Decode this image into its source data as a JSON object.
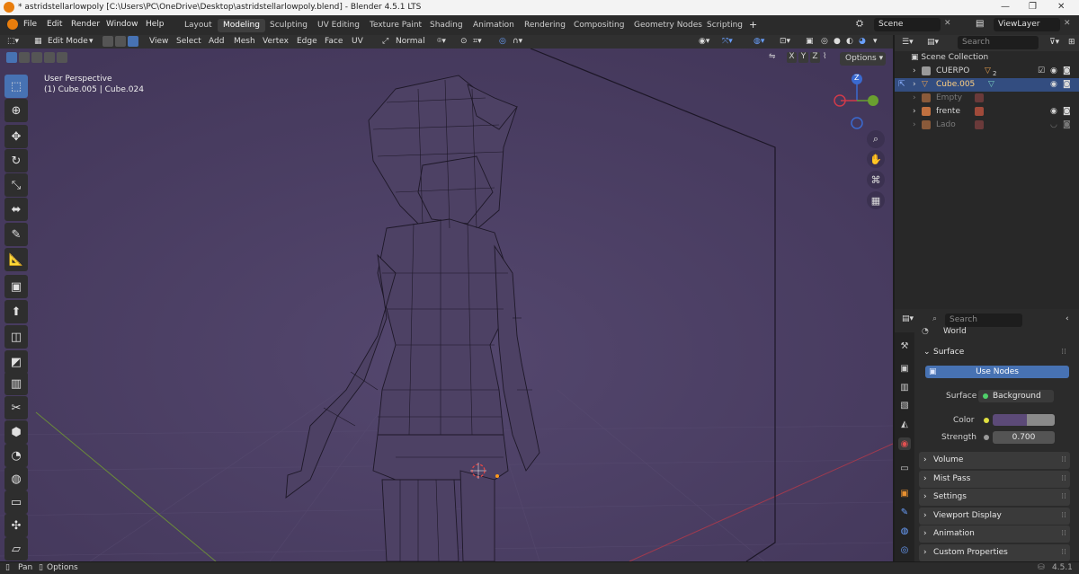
{
  "window": {
    "title": "* astridstellarlowpoly [C:\\Users\\PC\\OneDrive\\Desktop\\astridstellarlowpoly.blend] - Blender 4.5.1 LTS",
    "minimize": "—",
    "maximize": "❐",
    "close": "✕"
  },
  "menu": {
    "items": [
      "File",
      "Edit",
      "Render",
      "Window",
      "Help"
    ],
    "workspaces": [
      "Layout",
      "Modeling",
      "Sculpting",
      "UV Editing",
      "Texture Paint",
      "Shading",
      "Animation",
      "Rendering",
      "Compositing",
      "Geometry Nodes",
      "Scripting"
    ],
    "active_workspace": "Modeling",
    "add_tab": "+",
    "scene": "Scene",
    "view_layer": "ViewLayer"
  },
  "viewport_header": {
    "mode": "Edit Mode",
    "menus": [
      "View",
      "Select",
      "Add",
      "Mesh",
      "Vertex",
      "Edge",
      "Face",
      "UV"
    ],
    "orientation": "Normal",
    "axes": [
      "X",
      "Y",
      "Z"
    ],
    "options": "Options"
  },
  "viewport": {
    "perspective": "User Perspective",
    "object_info": "(1) Cube.005 | Cube.024",
    "background_color": "#4a3d63",
    "gizmo": {
      "x_label": "",
      "y_label": "",
      "z_label": "Z"
    }
  },
  "toolbar": {
    "tools": [
      "select-box",
      "cursor",
      "move",
      "rotate",
      "scale",
      "transform",
      "annotate",
      "measure",
      "add-cube",
      "extrude",
      "inset",
      "bevel",
      "loop-cut",
      "knife",
      "poly-build",
      "spin",
      "smooth",
      "edge-slide",
      "shrink-fatten",
      "shear"
    ],
    "glyphs": [
      "⬚",
      "⊕",
      "✥",
      "↻",
      "⤡",
      "⬌",
      "✎",
      "📐",
      "▣",
      "⬆",
      "◫",
      "◩",
      "▥",
      "✂",
      "⬢",
      "◔",
      "◍",
      "▭",
      "✣",
      "▱"
    ]
  },
  "outliner": {
    "search_placeholder": "Search",
    "root": "Scene Collection",
    "rows": [
      {
        "name": "CUERPO",
        "sub": "2",
        "color": "#9a9a9a"
      },
      {
        "name": "Cube.005",
        "sub": "",
        "color": "#e0a040"
      },
      {
        "name": "Empty",
        "sub": "",
        "color": "#7a7a7a"
      },
      {
        "name": "frente",
        "sub": "",
        "color": "#d0d0d0"
      },
      {
        "name": "Lado",
        "sub": "",
        "color": "#7a7a7a"
      }
    ]
  },
  "properties": {
    "search_placeholder": "Search",
    "world_name": "World",
    "surface_panel": "Surface",
    "use_nodes": "Use Nodes",
    "surface_label": "Surface",
    "surface_value": "Background",
    "color_label": "Color",
    "color_value": "#5c4a78",
    "strength_label": "Strength",
    "strength_value": "0.700",
    "panels": [
      "Volume",
      "Mist Pass",
      "Settings",
      "Viewport Display",
      "Animation",
      "Custom Properties"
    ]
  },
  "status": {
    "pan": "Pan",
    "options": "Options",
    "version": "4.5.1"
  }
}
